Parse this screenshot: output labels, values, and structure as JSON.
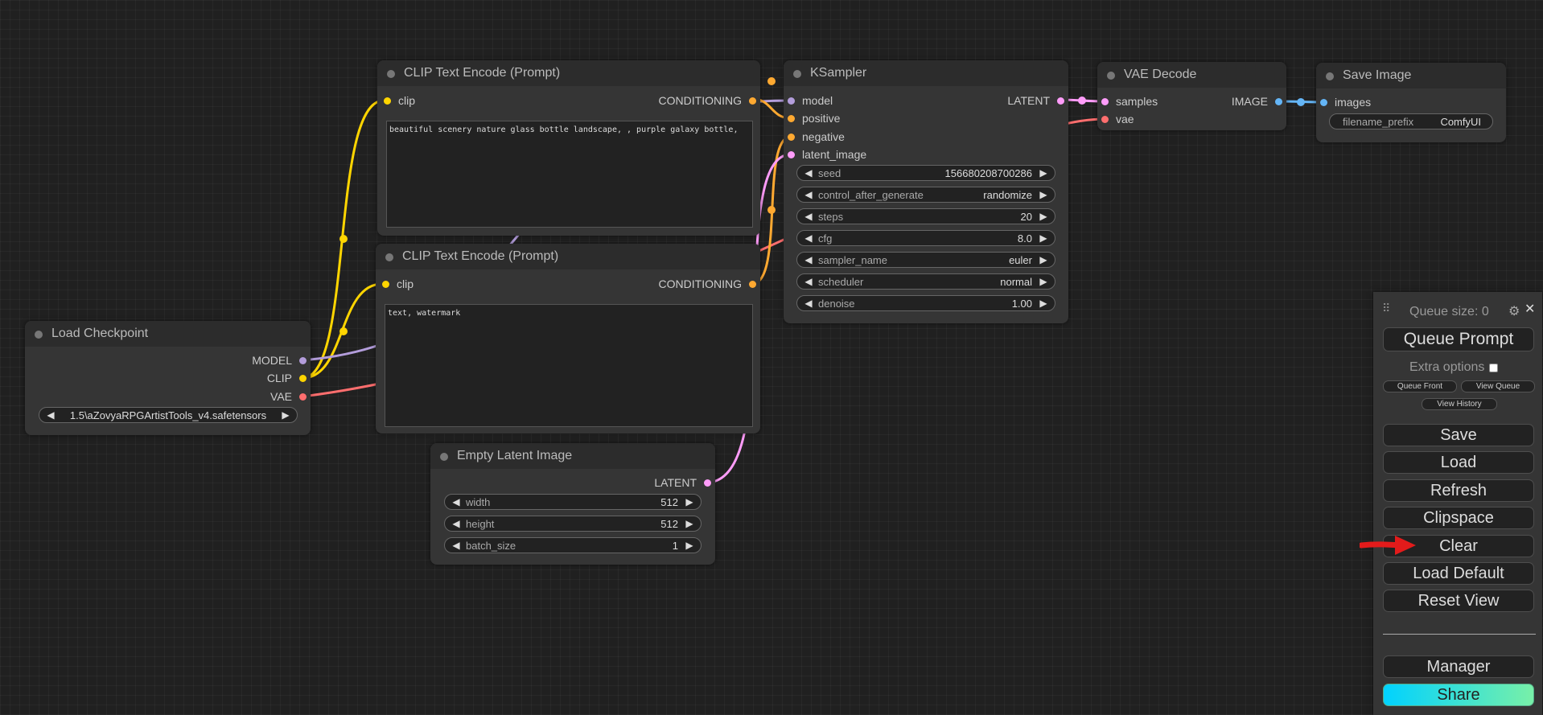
{
  "colors": {
    "model": "#b39ddb",
    "clip": "#ffd500",
    "vae": "#ff6e6e",
    "conditioning": "#ffa931",
    "latent": "#ff9cf9",
    "image": "#64b5f6",
    "canvas": "#202020",
    "node": "#353535",
    "annotation_arrow": "#e31b1b"
  },
  "nodes": {
    "clip_pos": {
      "title": "CLIP Text Encode (Prompt)",
      "in_clip": "clip",
      "out_cond": "CONDITIONING",
      "text": "beautiful scenery nature glass bottle landscape, , purple galaxy bottle,"
    },
    "clip_neg": {
      "title": "CLIP Text Encode (Prompt)",
      "in_clip": "clip",
      "out_cond": "CONDITIONING",
      "text": "text, watermark"
    },
    "load_ckpt": {
      "title": "Load Checkpoint",
      "out_model": "MODEL",
      "out_clip": "CLIP",
      "out_vae": "VAE",
      "ckpt_value": "1.5\\aZovyaRPGArtistTools_v4.safetensors"
    },
    "empty_latent": {
      "title": "Empty Latent Image",
      "out_latent": "LATENT",
      "width_label": "width",
      "width_value": "512",
      "height_label": "height",
      "height_value": "512",
      "batch_label": "batch_size",
      "batch_value": "1"
    },
    "ksampler": {
      "title": "KSampler",
      "in_model": "model",
      "in_positive": "positive",
      "in_negative": "negative",
      "in_latent": "latent_image",
      "out_latent": "LATENT",
      "widgets": [
        {
          "label": "seed",
          "value": "156680208700286"
        },
        {
          "label": "control_after_generate",
          "value": "randomize"
        },
        {
          "label": "steps",
          "value": "20"
        },
        {
          "label": "cfg",
          "value": "8.0"
        },
        {
          "label": "sampler_name",
          "value": "euler"
        },
        {
          "label": "scheduler",
          "value": "normal"
        },
        {
          "label": "denoise",
          "value": "1.00"
        }
      ]
    },
    "vae_decode": {
      "title": "VAE Decode",
      "in_samples": "samples",
      "in_vae": "vae",
      "out_image": "IMAGE"
    },
    "save_image": {
      "title": "Save Image",
      "in_images": "images",
      "prefix_label": "filename_prefix",
      "prefix_value": "ComfyUI"
    }
  },
  "menu": {
    "drag_handle": "⠿",
    "queue_size": "Queue size: 0",
    "gear": "⚙",
    "close": "✕",
    "queue_prompt": "Queue Prompt",
    "extra_options": "Extra options",
    "queue_front": "Queue Front",
    "view_queue": "View Queue",
    "view_history": "View History",
    "save": "Save",
    "load": "Load",
    "refresh": "Refresh",
    "clipspace": "Clipspace",
    "clear": "Clear",
    "load_default": "Load Default",
    "reset_view": "Reset View",
    "manager": "Manager",
    "share": "Share"
  }
}
